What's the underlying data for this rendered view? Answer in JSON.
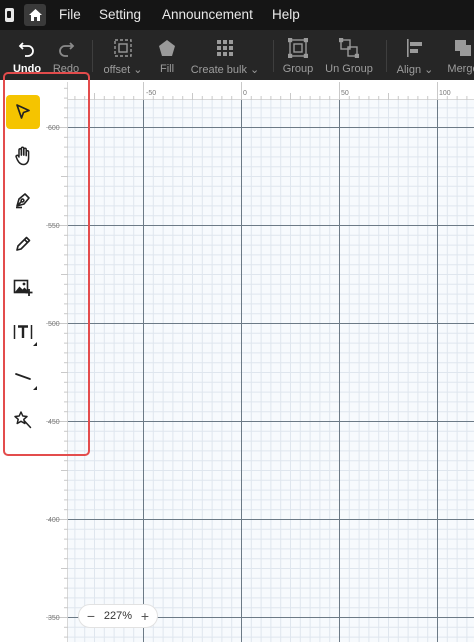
{
  "menubar": {
    "items": [
      {
        "label": "File"
      },
      {
        "label": "Setting"
      },
      {
        "label": "Announcement"
      },
      {
        "label": "Help"
      }
    ]
  },
  "toolbar": {
    "undo_label": "Undo",
    "redo_label": "Redo",
    "offset_label": "offset",
    "fill_label": "Fill",
    "create_bulk_label": "Create bulk",
    "group_label": "Group",
    "ungroup_label": "Un Group",
    "align_label": "Align",
    "merge_label": "Merge"
  },
  "left_tools": [
    {
      "name": "select-tool",
      "icon": "cursor-arrow-icon",
      "active": true
    },
    {
      "name": "hand-tool",
      "icon": "hand-icon",
      "active": false
    },
    {
      "name": "pen-tool",
      "icon": "pen-nib-icon",
      "active": false
    },
    {
      "name": "pencil-tool",
      "icon": "pencil-icon",
      "active": false
    },
    {
      "name": "image-tool",
      "icon": "image-add-icon",
      "active": false
    },
    {
      "name": "text-tool",
      "icon": "text-icon",
      "active": false
    },
    {
      "name": "line-tool",
      "icon": "line-icon",
      "active": false
    },
    {
      "name": "magic-tool",
      "icon": "magic-star-icon",
      "active": false
    }
  ],
  "ruler_top": {
    "labels": [
      "-50",
      "0",
      "50",
      "100"
    ]
  },
  "ruler_left": {
    "labels": [
      "600",
      "550",
      "500",
      "450",
      "400",
      "350"
    ]
  },
  "zoom": {
    "minus": "−",
    "value": "227%",
    "plus": "+"
  },
  "colors": {
    "menubar_bg": "#151515",
    "toolbar_bg": "#262626",
    "active_tool": "#f5c400",
    "highlight_outline": "#e34c4c",
    "canvas_bg": "#f7fafd"
  }
}
